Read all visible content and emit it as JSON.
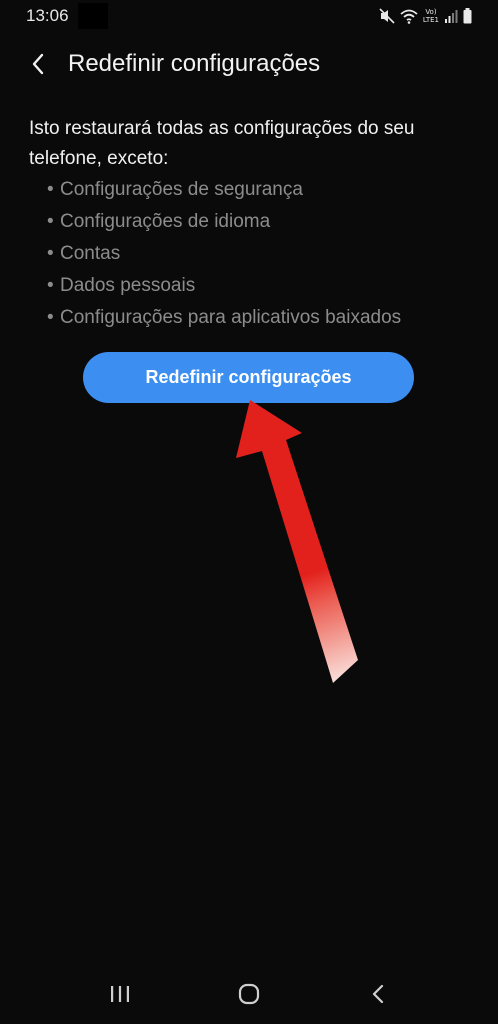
{
  "status_bar": {
    "time": "13:06",
    "volte_line1": "Vo)",
    "volte_line2": "LTE1"
  },
  "header": {
    "title": "Redefinir configurações"
  },
  "main": {
    "description": "Isto restaurará todas as configurações do seu telefone, exceto:",
    "exceptions": [
      "Configurações de segurança",
      "Configurações de idioma",
      "Contas",
      "Dados pessoais",
      "Configurações para aplicativos baixados"
    ],
    "reset_button_label": "Redefinir configurações"
  },
  "colors": {
    "background": "#0a0a0b",
    "accent": "#3c8ff0",
    "secondary_text": "#8c8c8c",
    "annotation_arrow": "#e3211c"
  },
  "icons": {
    "back": "chevron-left-icon",
    "nav_recents": "recents-icon",
    "nav_home": "home-icon",
    "nav_back": "back-icon"
  }
}
